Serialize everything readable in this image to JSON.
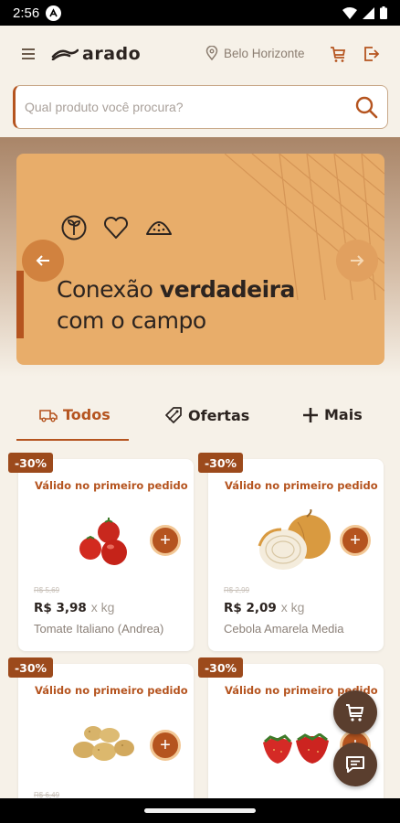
{
  "status": {
    "time": "2:56"
  },
  "header": {
    "logo_text": "arado",
    "location": "Belo Horizonte",
    "search_placeholder": "Qual produto você procura?"
  },
  "banner": {
    "headline_regular": "Conexão ",
    "headline_bold": "verdadeira",
    "headline_line2": "com o campo"
  },
  "tabs": [
    {
      "label": "Todos",
      "icon": "truck-icon",
      "active": true
    },
    {
      "label": "Ofertas",
      "icon": "tag-icon",
      "active": false
    },
    {
      "label": "Mais",
      "icon": "plus-icon",
      "active": false
    }
  ],
  "products": [
    {
      "discount": "-30%",
      "promo": "Válido no primeiro pedido",
      "old_price": "R$ 5,69",
      "price": "R$ 3,98",
      "unit": "x kg",
      "name": "Tomate Italiano (Andrea)",
      "image": "tomato"
    },
    {
      "discount": "-30%",
      "promo": "Válido no primeiro pedido",
      "old_price": "R$ 2,99",
      "price": "R$ 2,09",
      "unit": "x kg",
      "name": "Cebola Amarela Media",
      "image": "onion"
    },
    {
      "discount": "-30%",
      "promo": "Válido no primeiro pedido",
      "old_price": "R$ 6,49",
      "price": "",
      "unit": "",
      "name": "",
      "image": "potato"
    },
    {
      "discount": "-30%",
      "promo": "Válido no primeiro pedido",
      "old_price": "",
      "price": "",
      "unit": "",
      "name": "",
      "image": "strawberry"
    }
  ],
  "colors": {
    "accent": "#b5541f",
    "banner": "#e8ad6a",
    "background": "#f6f1e8",
    "fab": "#5a3e2e"
  }
}
